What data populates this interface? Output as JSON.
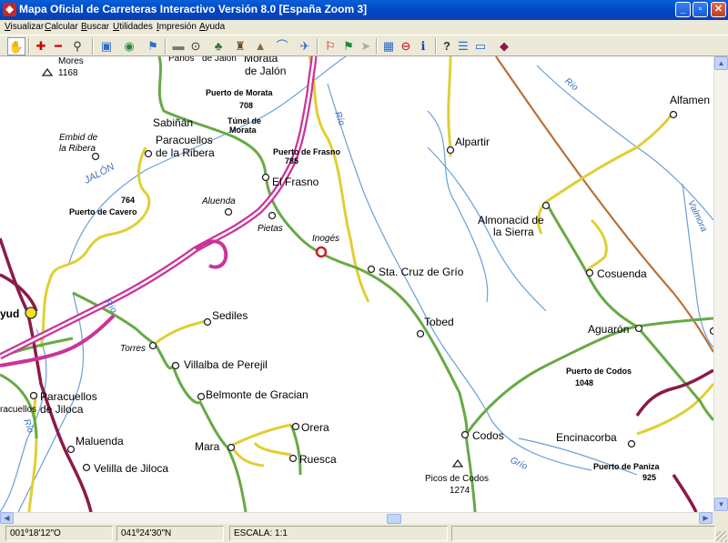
{
  "window": {
    "title": "Mapa Oficial de Carreteras Interactivo Versión 8.0  [España Zoom 3]",
    "controls": {
      "minimize": "_",
      "maximize": "▫",
      "close": "✕"
    }
  },
  "menu": {
    "items": [
      {
        "label": "Visualizar"
      },
      {
        "label": "Calcular"
      },
      {
        "label": "Buscar"
      },
      {
        "label": "Utilidades"
      },
      {
        "label": "Impresión"
      },
      {
        "label": "Ayuda"
      }
    ]
  },
  "toolbar": {
    "buttons": [
      {
        "icon": "hand-icon",
        "glyph": "✋"
      },
      {
        "icon": "zoom-in-icon",
        "glyph": "✚"
      },
      {
        "icon": "zoom-out-icon",
        "glyph": "━"
      },
      {
        "icon": "magnifier-icon",
        "glyph": "⚲"
      },
      {
        "icon": "map-view-icon",
        "glyph": "▣"
      },
      {
        "icon": "globe-icon",
        "glyph": "◉"
      },
      {
        "icon": "route-icon",
        "glyph": "⚑"
      },
      {
        "icon": "ruler-icon",
        "glyph": "▬"
      },
      {
        "icon": "point-icon",
        "glyph": "⊙"
      },
      {
        "icon": "tree-icon",
        "glyph": "♣"
      },
      {
        "icon": "castle-icon",
        "glyph": "♜"
      },
      {
        "icon": "mountain-icon",
        "glyph": "▲"
      },
      {
        "icon": "bridge-icon",
        "glyph": "⌒"
      },
      {
        "icon": "airplane-icon",
        "glyph": "✈"
      },
      {
        "icon": "flag-start-icon",
        "glyph": "⚐"
      },
      {
        "icon": "flag-stop-icon",
        "glyph": "⚑"
      },
      {
        "icon": "arrow-right-icon",
        "glyph": "➤"
      },
      {
        "icon": "calendar-icon",
        "glyph": "▦"
      },
      {
        "icon": "no-entry-icon",
        "glyph": "⊖"
      },
      {
        "icon": "info-icon",
        "glyph": "ℹ"
      },
      {
        "icon": "help-icon",
        "glyph": "?"
      },
      {
        "icon": "list-icon",
        "glyph": "☰"
      },
      {
        "icon": "window-icon",
        "glyph": "▭"
      },
      {
        "icon": "book-icon",
        "glyph": "◆"
      }
    ]
  },
  "map": {
    "colors": {
      "motorway": "#cc3399",
      "national_road": "#8b1a4a",
      "regional_road": "#66aa44",
      "local_road": "#e0cf34",
      "river": "#6a9fd8",
      "railway": "#b8703a"
    },
    "towns": [
      {
        "name": "Morata",
        "line2": "de Jalón"
      },
      {
        "name": "Sabiñán"
      },
      {
        "name": "Paracuellos",
        "line2": "de la Ribera"
      },
      {
        "name": "Embid de",
        "line2": "la Ribera"
      },
      {
        "name": "El Frasno"
      },
      {
        "name": "Aluenda"
      },
      {
        "name": "Pietas"
      },
      {
        "name": "Inogés"
      },
      {
        "name": "Sta. Cruz de Grío"
      },
      {
        "name": "Alpartir"
      },
      {
        "name": "Alfamen"
      },
      {
        "name": "Almonacid de",
        "line2": "la Sierra"
      },
      {
        "name": "Cosuenda"
      },
      {
        "name": "Tobed"
      },
      {
        "name": "Aguarón"
      },
      {
        "name": "Sediles"
      },
      {
        "name": "Torres"
      },
      {
        "name": "Villalba de Perejil"
      },
      {
        "name": "Belmonte de Gracian"
      },
      {
        "name": "Paracuellos",
        "line2": "de Jiloca"
      },
      {
        "name": "Orera"
      },
      {
        "name": "Mara"
      },
      {
        "name": "Ruesca"
      },
      {
        "name": "Maluenda"
      },
      {
        "name": "Velilla de Jiloca"
      },
      {
        "name": "Codos"
      },
      {
        "name": "Encinacorba"
      },
      {
        "name": "Picos de Codos",
        "line2": "1274"
      },
      {
        "name": "Mores",
        "line2": "1168"
      },
      {
        "name": "Paños",
        "line2": "de Jalón"
      },
      {
        "name": "yud"
      },
      {
        "name": "racuellos"
      }
    ],
    "passes": [
      {
        "name": "Puerto de Morata",
        "alt": "708"
      },
      {
        "name": "Túnel de",
        "line2": "Morata"
      },
      {
        "name": "Puerto de Frasno",
        "alt": "785"
      },
      {
        "name": "Puerto de Cavero",
        "alt": "764"
      },
      {
        "name": "Puerto de Codos",
        "alt": "1048"
      },
      {
        "name": "Puerto de Paniza",
        "alt": "925"
      }
    ],
    "rivers": [
      {
        "name": "JALÓN"
      },
      {
        "name": "Río"
      },
      {
        "name": "Río"
      },
      {
        "name": "Río"
      },
      {
        "name": "Río"
      },
      {
        "name": "Grío"
      },
      {
        "name": "Valmora"
      }
    ]
  },
  "status": {
    "longitude": "001º18'12\"O",
    "latitude": "041º24'30\"N",
    "scale": "ESCALA: 1:1"
  }
}
